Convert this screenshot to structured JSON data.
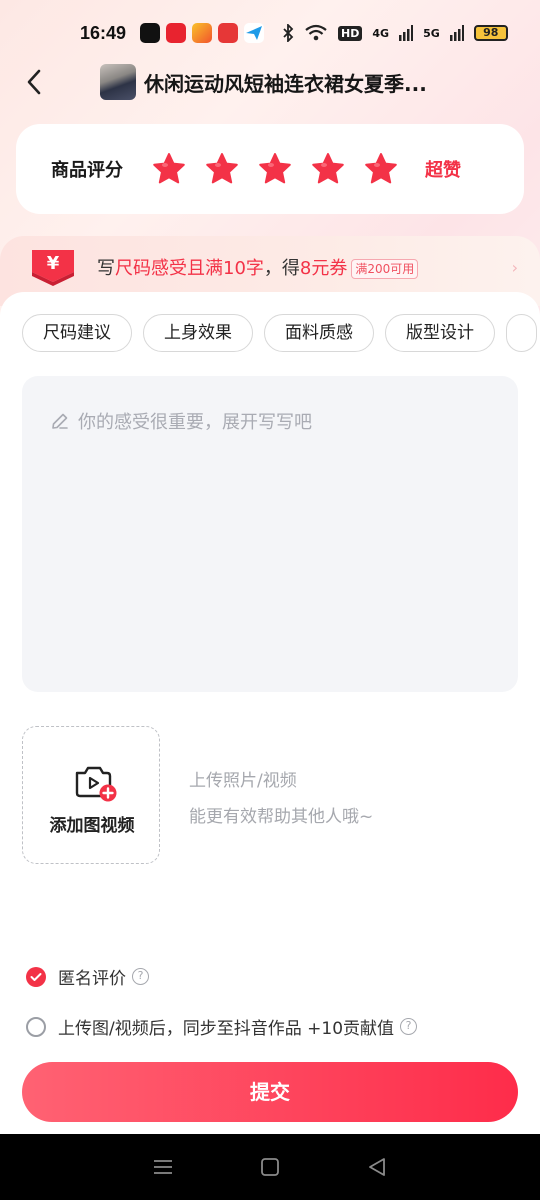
{
  "status_bar": {
    "time": "16:49",
    "network_hd": "HD",
    "network_4g": "4G",
    "network_5g": "5G",
    "battery": "98"
  },
  "header": {
    "title": "休闲运动风短袖连衣裙女夏季...",
    "back_icon": "chevron-left-icon"
  },
  "rating": {
    "label": "商品评分",
    "stars": 5,
    "max_stars": 5,
    "result": "超赞",
    "star_color": "#f33247"
  },
  "coupon": {
    "prefix": "写",
    "highlight1": "尺码感受且满10字",
    "middle": "，得",
    "highlight2": "8元券",
    "tag": "满200可用",
    "icon": "yuan-coupon-icon"
  },
  "chips": [
    "尺码建议",
    "上身效果",
    "面料质感",
    "版型设计"
  ],
  "review": {
    "placeholder": "你的感受很重要，展开写写吧"
  },
  "upload": {
    "label": "添加图视频",
    "hint1": "上传照片/视频",
    "hint2": "能更有效帮助其他人哦~"
  },
  "options": {
    "anonymous": "匿名评价",
    "sync": "上传图/视频后，同步至抖音作品 +10贡献值"
  },
  "submit_label": "提交",
  "colors": {
    "accent": "#f33247",
    "submit_start": "#ff6273",
    "submit_end": "#fe2c4a"
  }
}
